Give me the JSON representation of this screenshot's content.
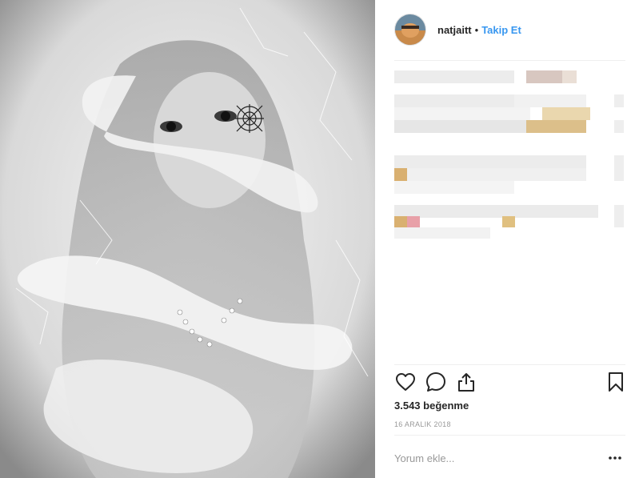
{
  "header": {
    "username": "natjaitt",
    "separator": "•",
    "follow_label": "Takip Et",
    "avatar_icon": "profile-avatar"
  },
  "caption": {
    "status": "pixelated / obscured text"
  },
  "actions": {
    "like_icon": "heart-icon",
    "comment_icon": "comment-icon",
    "share_icon": "share-icon",
    "save_icon": "bookmark-icon"
  },
  "likes": {
    "text": "3.543 beğenme"
  },
  "date": {
    "text": "16 ARALIK 2018"
  },
  "comment": {
    "placeholder": "Yorum ekle...",
    "more_icon": "more-options-icon"
  },
  "colors": {
    "link": "#3897f0",
    "text": "#262626",
    "muted": "#999999",
    "divider": "#efefef"
  }
}
